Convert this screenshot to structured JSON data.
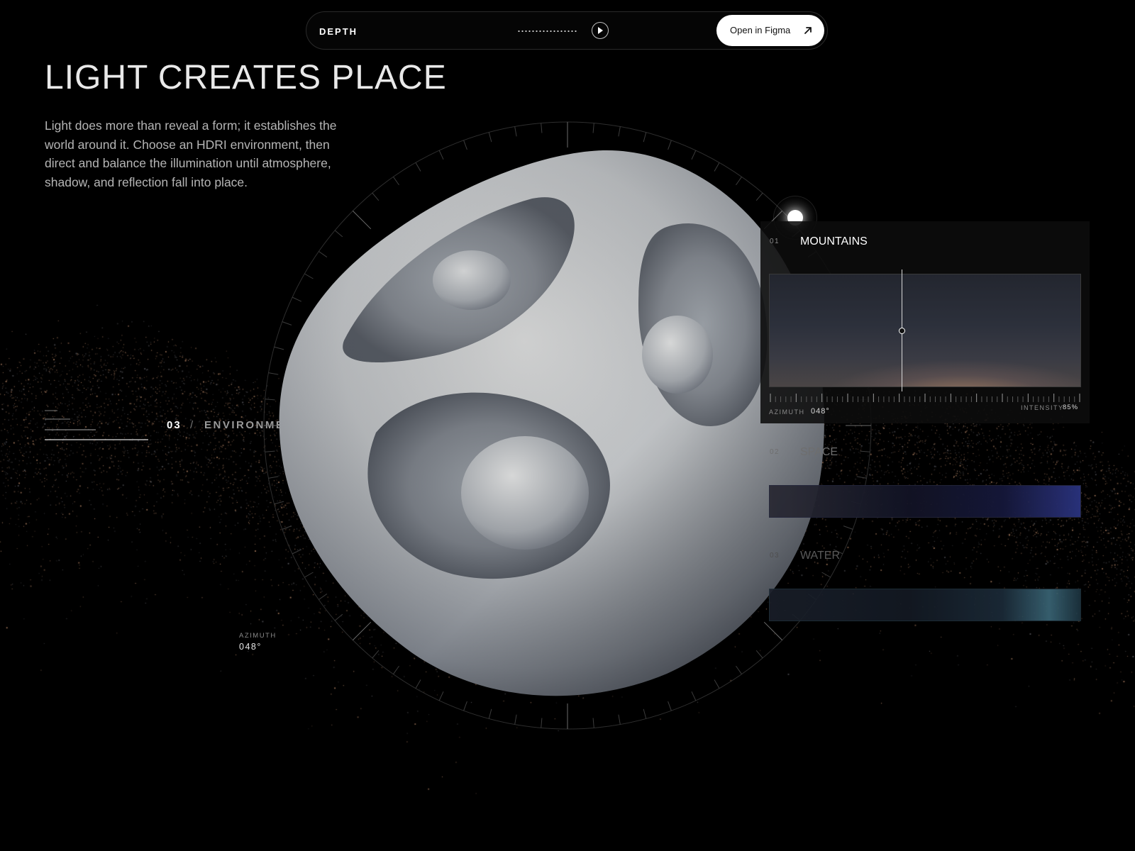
{
  "header": {
    "brand": "DEPTH",
    "cta_label": "Open in Figma"
  },
  "hero": {
    "title": "LIGHT CREATES PLACE",
    "intro": "Light does more than reveal a form; it establishes the world around it. Choose an HDRI environment, then direct and balance the illumination until atmosphere, shadow, and reflection fall into place."
  },
  "section": {
    "number": "03",
    "separator": "/",
    "name": "ENVIRONMENT"
  },
  "readout": {
    "azimuth_label": "AZIMUTH",
    "azimuth_value": "048°"
  },
  "environments": [
    {
      "number": "01",
      "name": "MOUNTAINS",
      "active": true
    },
    {
      "number": "02",
      "name": "SPACE",
      "active": false
    },
    {
      "number": "03",
      "name": "WATER",
      "active": false
    }
  ],
  "panel": {
    "azimuth_label": "AZIMUTH",
    "azimuth_value": "048°",
    "intensity_label": "INTENSITY",
    "intensity_value": "85%"
  },
  "colors": {
    "background": "#000000",
    "accent": "#ffffff",
    "particle": "#a07a5c"
  },
  "icons": [
    "play-icon",
    "arrow-up-right-icon",
    "light-source-icon"
  ]
}
